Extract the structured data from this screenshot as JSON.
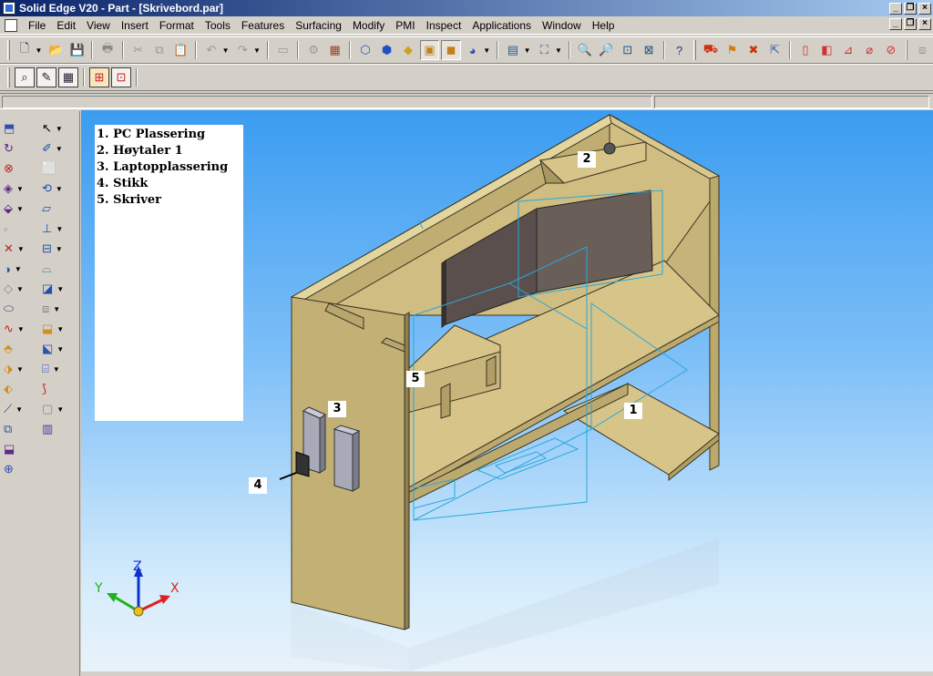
{
  "window": {
    "title": "Solid Edge V20 - Part - [Skrivebord.par]"
  },
  "menu": {
    "items": [
      "File",
      "Edit",
      "View",
      "Insert",
      "Format",
      "Tools",
      "Features",
      "Surfacing",
      "Modify",
      "PMI",
      "Inspect",
      "Applications",
      "Window",
      "Help"
    ]
  },
  "notes": {
    "items": [
      "1. PC Plassering",
      "2. Høytaler 1",
      "3. Laptopplassering",
      "4. Stikk",
      "5. Skriver"
    ]
  },
  "callouts": {
    "c1": "1",
    "c2": "2",
    "c3": "3",
    "c4": "4",
    "c5": "5"
  },
  "axes": {
    "x": "X",
    "y": "Y",
    "z": "Z",
    "colors": {
      "x": "#e02020",
      "y": "#20b020",
      "z": "#1030d0"
    }
  },
  "colors": {
    "title_gradient_start": "#0a246a",
    "viewport_top": "#3b9cf0",
    "wood": "#d6c489",
    "glass": "#5a4f4c",
    "wire": "#2aa8d8"
  },
  "icons": {
    "toolbar1": [
      "new-icon",
      "open-icon",
      "save-icon",
      "print-icon",
      "cut-icon",
      "copy-icon",
      "paste-icon",
      "undo-icon",
      "redo-icon",
      "cube-icon",
      "view-iso-icon",
      "shade-icon",
      "render-icon",
      "sphere-icon",
      "display-icon",
      "fit-icon",
      "zoom-area-icon",
      "zoom-icon",
      "fit-window-icon",
      "pan-icon",
      "help-icon",
      "tools-icon"
    ],
    "toolbar2": [
      "select-tool-icon",
      "sketch-icon",
      "profile-icon",
      "constraint-icon",
      "section-icon"
    ]
  }
}
